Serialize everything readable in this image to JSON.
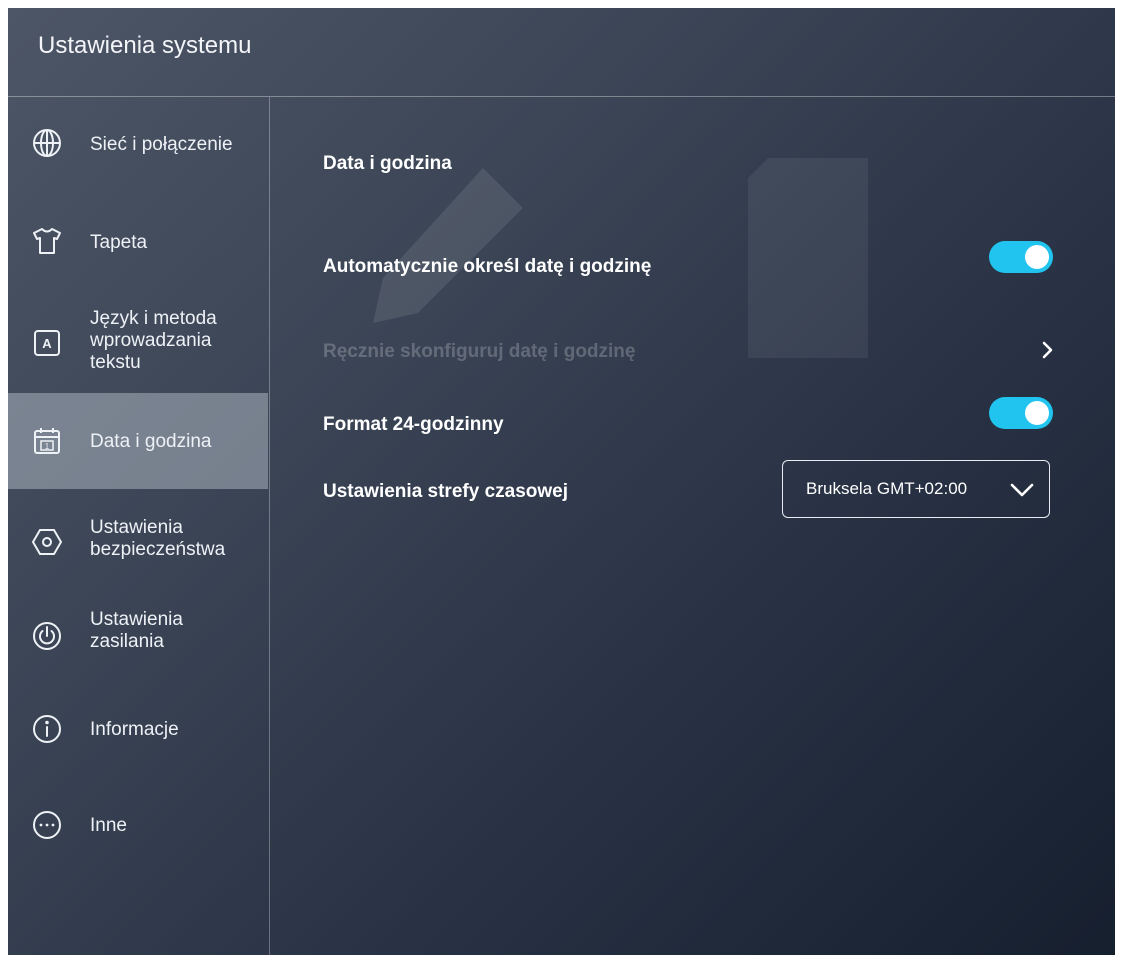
{
  "header": {
    "title": "Ustawienia systemu"
  },
  "sidebar": {
    "items": [
      {
        "label": "Sieć i połączenie",
        "icon": "globe-icon",
        "active": false
      },
      {
        "label": "Tapeta",
        "icon": "tshirt-icon",
        "active": false
      },
      {
        "label": "Język i metoda\nwprowadzania\ntekstu",
        "icon": "language-icon",
        "active": false
      },
      {
        "label": "Data i godzina",
        "icon": "calendar-icon",
        "active": true
      },
      {
        "label": "Ustawienia\nbezpieczeństwa",
        "icon": "security-icon",
        "active": false
      },
      {
        "label": "Ustawienia\nzasilania",
        "icon": "power-icon",
        "active": false
      },
      {
        "label": "Informacje",
        "icon": "info-icon",
        "active": false
      },
      {
        "label": "Inne",
        "icon": "more-icon",
        "active": false
      }
    ]
  },
  "main": {
    "section_title": "Data i godzina",
    "auto_datetime": {
      "label": "Automatycznie określ datę i godzinę",
      "enabled": true
    },
    "manual_datetime": {
      "label": "Ręcznie skonfiguruj datę i godzinę",
      "disabled": true
    },
    "format_24h": {
      "label": "Format 24-godzinny",
      "enabled": true
    },
    "timezone": {
      "label": "Ustawienia strefy czasowej",
      "value": "Bruksela GMT+02:00"
    }
  },
  "colors": {
    "accent": "#21c4ee",
    "active_item": "#8e96a3"
  }
}
